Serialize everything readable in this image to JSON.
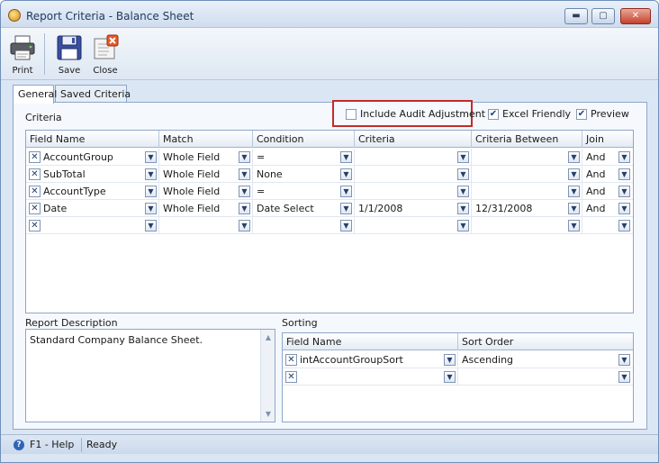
{
  "window": {
    "title": "Report Criteria - Balance Sheet",
    "controls": {
      "minimize": "▬",
      "maximize": "▢",
      "close": "✕"
    }
  },
  "toolbar": {
    "print_label": "Print",
    "save_label": "Save",
    "close_label": "Close"
  },
  "tabs": [
    {
      "label": "General",
      "active": true
    },
    {
      "label": "Saved Criteria",
      "active": false
    }
  ],
  "criteria": {
    "section_label": "Criteria",
    "options": {
      "include_audit_adjustment": {
        "label": "Include Audit Adjustment",
        "checked": false,
        "mark": ""
      },
      "excel_friendly": {
        "label": "Excel Friendly",
        "checked": true,
        "mark": "✔"
      },
      "preview": {
        "label": "Preview",
        "checked": true,
        "mark": "✔"
      }
    },
    "columns": [
      "Field Name",
      "Match",
      "Condition",
      "Criteria",
      "Criteria Between",
      "Join"
    ],
    "rows": [
      [
        "AccountGroup",
        "Whole Field",
        "=",
        "",
        "",
        "And"
      ],
      [
        "SubTotal",
        "Whole Field",
        "None",
        "",
        "",
        "And"
      ],
      [
        "AccountType",
        "Whole Field",
        "=",
        "",
        "",
        "And"
      ],
      [
        "Date",
        "Whole Field",
        "Date Select",
        "1/1/2008",
        "12/31/2008",
        "And"
      ],
      [
        "",
        "",
        "",
        "",
        "",
        ""
      ]
    ]
  },
  "report_description": {
    "label": "Report Description",
    "text": "Standard Company Balance Sheet."
  },
  "sorting": {
    "label": "Sorting",
    "columns": [
      "Field Name",
      "Sort Order"
    ],
    "rows": [
      [
        "intAccountGroupSort",
        "Ascending"
      ],
      [
        "",
        ""
      ]
    ]
  },
  "statusbar": {
    "help": "F1 - Help",
    "status": "Ready"
  },
  "colors": {
    "highlight_border": "#c42b2b",
    "window_bg": "#dbe6f4"
  }
}
